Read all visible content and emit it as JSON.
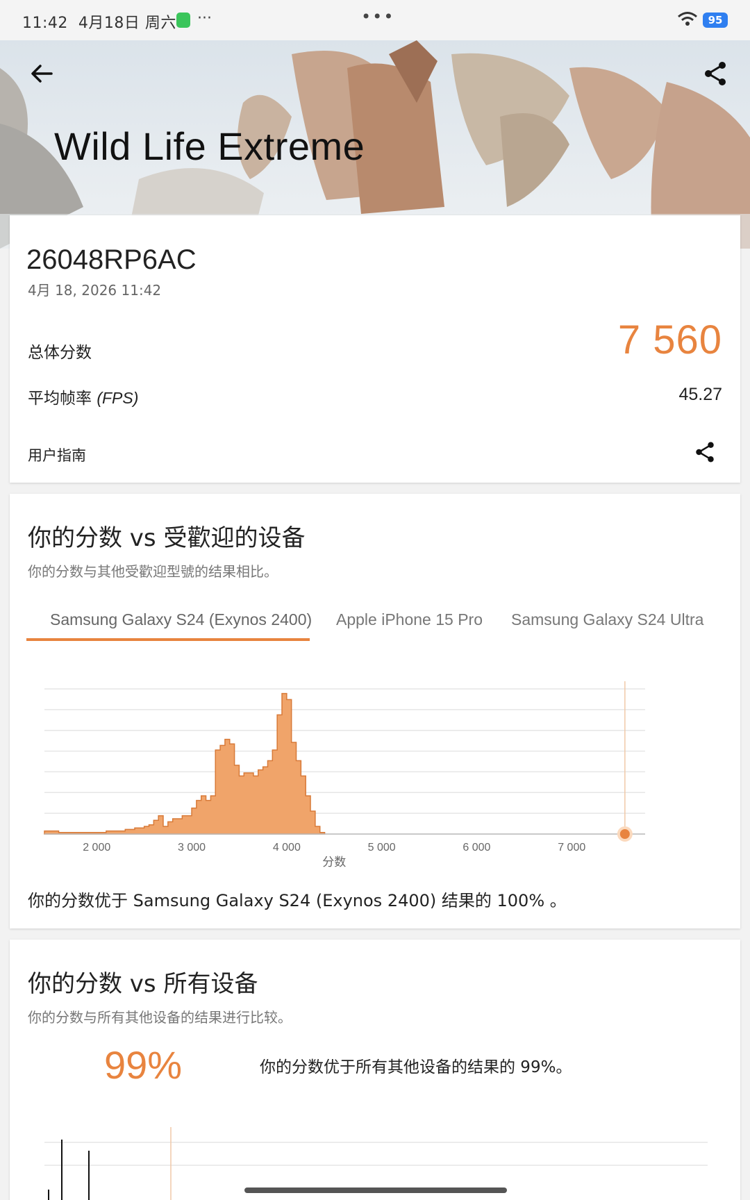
{
  "status_bar": {
    "time": "11:42",
    "date": "4月18日 周六",
    "overflow": "···",
    "center_menu": "•••",
    "battery": "95"
  },
  "header": {
    "title": "Wild Life Extreme"
  },
  "result_card": {
    "device_name": "26048RP6AC",
    "timestamp": "4月 18, 2026 11:42",
    "overall_label": "总体分数",
    "overall_score": "7 560",
    "fps_label_cn": "平均帧率",
    "fps_label_unit": "(FPS)",
    "fps_value": "45.27",
    "user_guide": "用户指南"
  },
  "popular_card": {
    "title": "你的分数 vs 受歡迎的设备",
    "subtitle": "你的分数与其他受歡迎型號的结果相比。",
    "tabs": [
      {
        "label": "Samsung Galaxy S24 (Exynos 2400)",
        "active": true
      },
      {
        "label": "Apple iPhone 15 Pro",
        "active": false
      },
      {
        "label": "Samsung Galaxy S24 Ultra",
        "active": false
      }
    ],
    "result_text": "你的分数优于 Samsung Galaxy S24 (Exynos 2400) 结果的 100% 。"
  },
  "all_card": {
    "title": "你的分数 vs 所有设备",
    "subtitle": "你的分数与所有其他设备的结果进行比较。",
    "percent": "99%",
    "percent_text": "你的分数优于所有其他设备的结果的 99%。"
  },
  "colors": {
    "accent": "#e8843f",
    "histogram_fill": "#f0a46a"
  },
  "chart_data": {
    "type": "area",
    "xlabel": "分数",
    "x_ticks": [
      2000,
      3000,
      4000,
      5000,
      6000,
      7000
    ],
    "x_tick_labels": [
      "2 000",
      "3 000",
      "4 000",
      "5 000",
      "6 000",
      "7 000"
    ],
    "xlim": [
      1450,
      7700
    ],
    "ylim": [
      0,
      100
    ],
    "marker": {
      "x": 7560
    },
    "bins": [
      [
        1450,
        2
      ],
      [
        1600,
        1
      ],
      [
        1700,
        1
      ],
      [
        1800,
        1
      ],
      [
        1900,
        1
      ],
      [
        2000,
        1
      ],
      [
        2100,
        2
      ],
      [
        2200,
        2
      ],
      [
        2300,
        3
      ],
      [
        2400,
        4
      ],
      [
        2500,
        5
      ],
      [
        2550,
        6
      ],
      [
        2600,
        9
      ],
      [
        2650,
        12
      ],
      [
        2700,
        5
      ],
      [
        2750,
        8
      ],
      [
        2800,
        10
      ],
      [
        2850,
        10
      ],
      [
        2900,
        12
      ],
      [
        2950,
        12
      ],
      [
        3000,
        17
      ],
      [
        3050,
        22
      ],
      [
        3100,
        25
      ],
      [
        3150,
        22
      ],
      [
        3200,
        25
      ],
      [
        3250,
        55
      ],
      [
        3300,
        58
      ],
      [
        3350,
        62
      ],
      [
        3400,
        59
      ],
      [
        3450,
        45
      ],
      [
        3500,
        38
      ],
      [
        3550,
        40
      ],
      [
        3600,
        40
      ],
      [
        3650,
        38
      ],
      [
        3700,
        42
      ],
      [
        3750,
        44
      ],
      [
        3800,
        48
      ],
      [
        3850,
        55
      ],
      [
        3900,
        78
      ],
      [
        3950,
        92
      ],
      [
        4000,
        88
      ],
      [
        4050,
        60
      ],
      [
        4100,
        48
      ],
      [
        4150,
        38
      ],
      [
        4200,
        25
      ],
      [
        4250,
        15
      ],
      [
        4300,
        5
      ],
      [
        4350,
        1
      ]
    ]
  }
}
